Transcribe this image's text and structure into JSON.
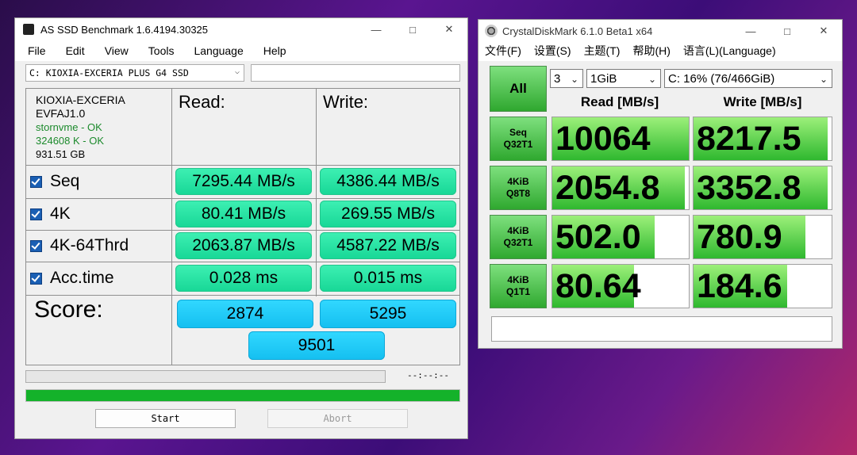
{
  "as_ssd": {
    "title": "AS SSD Benchmark 1.6.4194.30325",
    "menu": [
      "File",
      "Edit",
      "View",
      "Tools",
      "Language",
      "Help"
    ],
    "drive_select": "C: KIOXIA-EXCERIA PLUS G4 SSD",
    "info": {
      "model": "KIOXIA-EXCERIA",
      "firmware": "EVFAJ1.0",
      "driver": "stornvme - OK",
      "alignment": "324608 K - OK",
      "size": "931.51 GB"
    },
    "headers": {
      "read": "Read:",
      "write": "Write:"
    },
    "rows": [
      {
        "label": "Seq",
        "read": "7295.44 MB/s",
        "write": "4386.44 MB/s"
      },
      {
        "label": "4K",
        "read": "80.41 MB/s",
        "write": "269.55 MB/s"
      },
      {
        "label": "4K-64Thrd",
        "read": "2063.87 MB/s",
        "write": "4587.22 MB/s"
      },
      {
        "label": "Acc.time",
        "read": "0.028 ms",
        "write": "0.015 ms"
      }
    ],
    "score": {
      "label": "Score:",
      "read": "2874",
      "write": "5295",
      "total": "9501"
    },
    "time_display": "--:--:--",
    "progress": 1.0,
    "start_label": "Start",
    "abort_label": "Abort",
    "colors": {
      "result": "#22e0a0",
      "score": "#1ac8f6",
      "progress": "#14b22a"
    }
  },
  "cdm": {
    "title": "CrystalDiskMark 6.1.0 Beta1 x64",
    "menu": [
      "文件(F)",
      "设置(S)",
      "主题(T)",
      "帮助(H)",
      "语言(L)(Language)"
    ],
    "all_label": "All",
    "count": "3",
    "size": "1GiB",
    "drive": "C: 16% (76/466GiB)",
    "headers": {
      "read": "Read [MB/s]",
      "write": "Write [MB/s]"
    },
    "tests": [
      {
        "line1": "Seq",
        "line2": "Q32T1",
        "read": "10064",
        "write": "8217.5",
        "read_fill": 1.0,
        "write_fill": 0.97
      },
      {
        "line1": "4KiB",
        "line2": "Q8T8",
        "read": "2054.8",
        "write": "3352.8",
        "read_fill": 0.97,
        "write_fill": 0.97
      },
      {
        "line1": "4KiB",
        "line2": "Q32T1",
        "read": "502.0",
        "write": "780.9",
        "read_fill": 0.75,
        "write_fill": 0.81
      },
      {
        "line1": "4KiB",
        "line2": "Q1T1",
        "read": "80.64",
        "write": "184.6",
        "read_fill": 0.6,
        "write_fill": 0.68
      }
    ],
    "colors": {
      "bar": "#3dbb3d",
      "button": "#4cc24c"
    }
  }
}
